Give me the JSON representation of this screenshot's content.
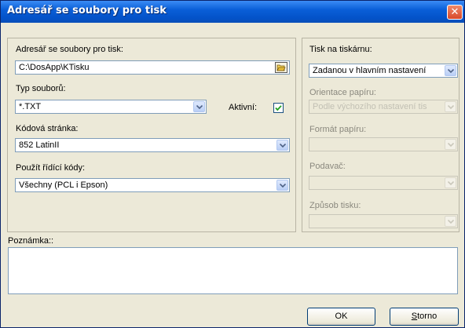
{
  "window": {
    "title": "Adresář se soubory pro tisk",
    "close_glyph": "✕"
  },
  "left": {
    "folder_label": "Adresář se soubory pro tisk:",
    "folder_value": "C:\\DosApp\\KTisku",
    "type_label": "Typ souborů:",
    "type_value": "*.TXT",
    "active_label": "Aktivní:",
    "active_checked": true,
    "codepage_label": "Kódová stránka:",
    "codepage_value": "852 LatinII",
    "codes_label": "Použít řídící kódy:",
    "codes_value": "Všechny (PCL i Epson)"
  },
  "right": {
    "printer_label": "Tisk na tiskárnu:",
    "printer_value": "Zadanou v hlavním nastavení",
    "orientation_label": "Orientace papíru:",
    "orientation_value": "Podle výchozího nastavení tis",
    "format_label": "Formát papíru:",
    "feeder_label": "Podavač:",
    "mode_label": "Způsob tisku:"
  },
  "note": {
    "label": "Poznámka::",
    "value": ""
  },
  "buttons": {
    "ok": "OK",
    "cancel_first": "S",
    "cancel_rest": "torno"
  },
  "icons": {
    "close": "close-icon",
    "browse": "folder-icon",
    "dropdown": "chevron-down-icon",
    "check": "checkmark-icon"
  }
}
